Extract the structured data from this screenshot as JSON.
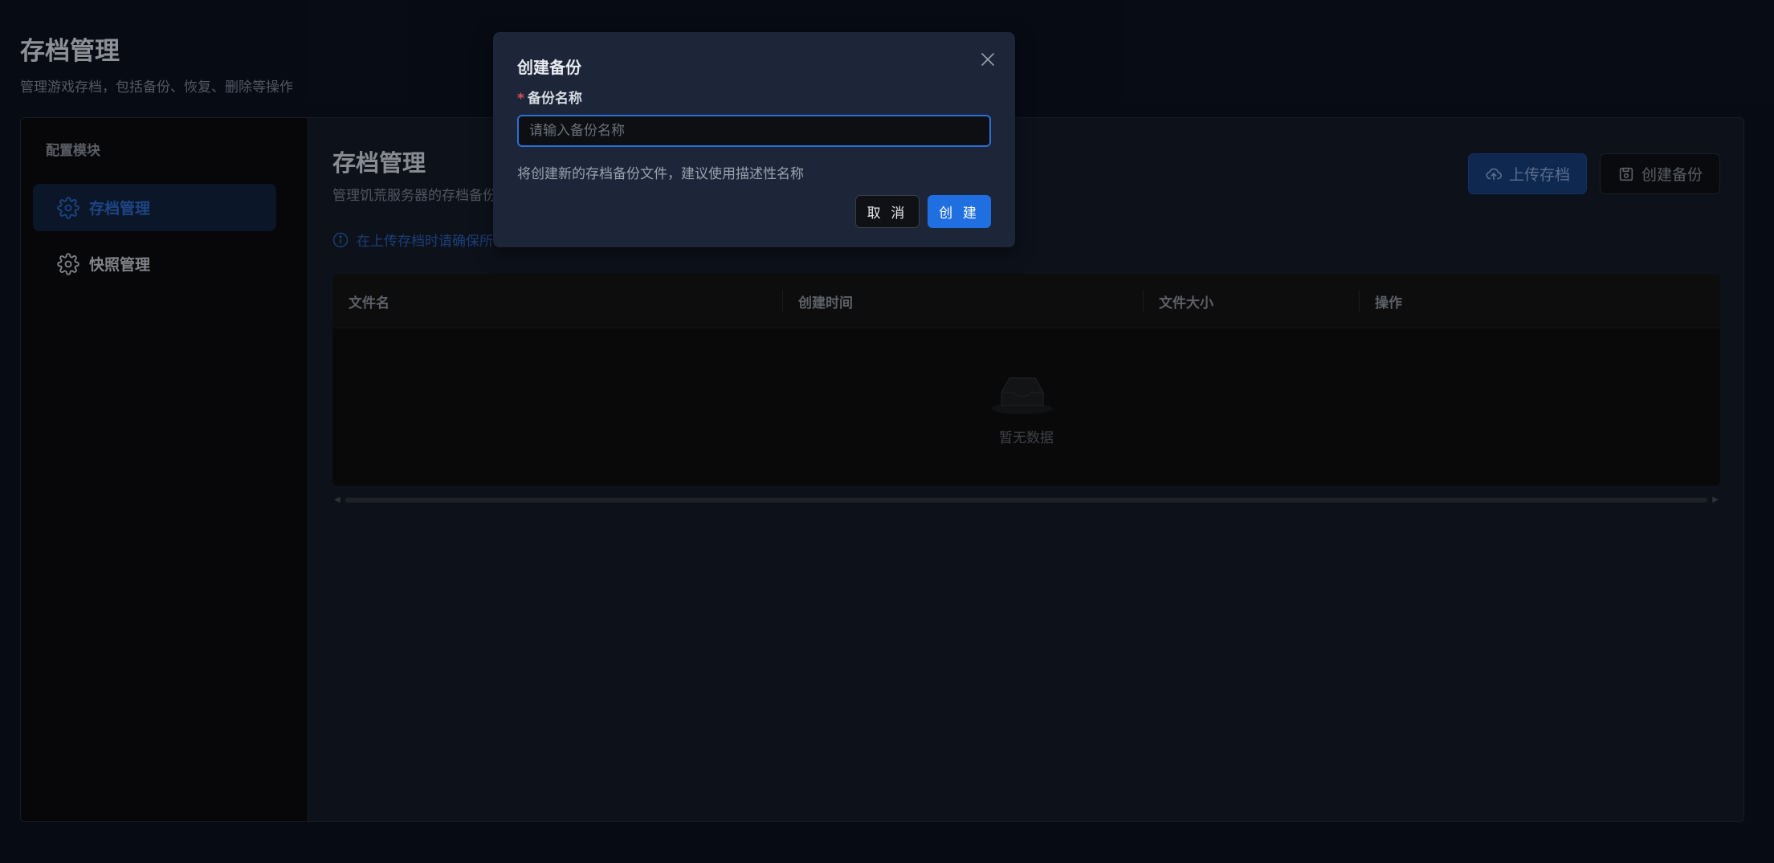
{
  "page": {
    "title": "存档管理",
    "subtitle": "管理游戏存档，包括备份、恢复、删除等操作"
  },
  "sidebar": {
    "title": "配置模块",
    "items": [
      {
        "label": "存档管理",
        "icon": "gear-icon",
        "active": true
      },
      {
        "label": "快照管理",
        "icon": "gear-icon",
        "active": false
      }
    ]
  },
  "content": {
    "title": "存档管理",
    "description": "管理饥荒服务器的存档备份",
    "notice": "在上传存档时请确保所",
    "upload_button": "上传存档",
    "create_backup_button": "创建备份"
  },
  "table": {
    "columns": [
      "文件名",
      "创建时间",
      "文件大小",
      "操作"
    ],
    "empty_text": "暂无数据"
  },
  "modal": {
    "title": "创建备份",
    "field_label": "备份名称",
    "input_placeholder": "请输入备份名称",
    "input_value": "",
    "hint": "将创建新的存档备份文件，建议使用描述性名称",
    "cancel_label": "取 消",
    "create_label": "创 建"
  },
  "colors": {
    "background": "#0b1220",
    "accent": "#1f6fe0",
    "active_nav_bg": "#13233f",
    "required_mark": "#e0525a"
  }
}
